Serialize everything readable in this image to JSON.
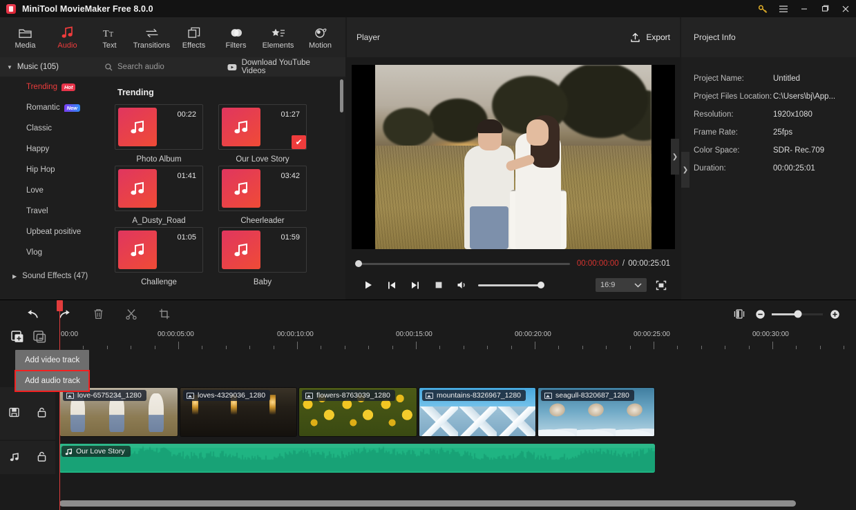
{
  "window": {
    "title": "MiniTool MovieMaker Free 8.0.0",
    "buttons": {
      "key": "key-icon",
      "menu": "hamburger-icon",
      "minimize": "—",
      "maximize": "❐",
      "close": "✕"
    }
  },
  "toolbar": {
    "tabs": [
      {
        "label": "Media",
        "icon": "folder-icon",
        "active": false
      },
      {
        "label": "Audio",
        "icon": "music-note-icon",
        "active": true
      },
      {
        "label": "Text",
        "icon": "text-icon",
        "active": false
      },
      {
        "label": "Transitions",
        "icon": "transitions-icon",
        "active": false
      },
      {
        "label": "Effects",
        "icon": "effects-icon",
        "active": false
      },
      {
        "label": "Filters",
        "icon": "filters-icon",
        "active": false
      },
      {
        "label": "Elements",
        "icon": "elements-icon",
        "active": false
      },
      {
        "label": "Motion",
        "icon": "motion-icon",
        "active": false
      }
    ]
  },
  "categories": {
    "music_header": "Music (105)",
    "items": [
      {
        "label": "Trending",
        "badge": "Hot",
        "badge_type": "red",
        "active": true
      },
      {
        "label": "Romantic",
        "badge": "New",
        "badge_type": "blue",
        "active": false
      },
      {
        "label": "Classic",
        "badge": "",
        "badge_type": "",
        "active": false
      },
      {
        "label": "Happy",
        "badge": "",
        "badge_type": "",
        "active": false
      },
      {
        "label": "Hip Hop",
        "badge": "",
        "badge_type": "",
        "active": false
      },
      {
        "label": "Love",
        "badge": "",
        "badge_type": "",
        "active": false
      },
      {
        "label": "Travel",
        "badge": "",
        "badge_type": "",
        "active": false
      },
      {
        "label": "Upbeat positive",
        "badge": "",
        "badge_type": "",
        "active": false
      },
      {
        "label": "Vlog",
        "badge": "",
        "badge_type": "",
        "active": false
      }
    ],
    "sound_effects": "Sound Effects (47)"
  },
  "library": {
    "search_placeholder": "Search audio",
    "download_label": "Download YouTube Videos",
    "section_title": "Trending",
    "tracks": [
      {
        "name": "Photo Album",
        "duration": "00:22",
        "selected": false
      },
      {
        "name": "Our Love Story",
        "duration": "01:27",
        "selected": true
      },
      {
        "name": "A_Dusty_Road",
        "duration": "01:41",
        "selected": false
      },
      {
        "name": "Cheerleader",
        "duration": "03:42",
        "selected": false
      },
      {
        "name": "Challenge",
        "duration": "01:05",
        "selected": false
      },
      {
        "name": "Baby",
        "duration": "01:59",
        "selected": false
      }
    ]
  },
  "player": {
    "title": "Player",
    "export_label": "Export",
    "current_time": "00:00:00:00",
    "separator": "/",
    "total_time": "00:00:25:01",
    "aspect_ratio": "16:9",
    "controls": [
      "play-button",
      "previous-frame-button",
      "next-frame-button",
      "stop-button",
      "volume-button",
      "fullscreen-button"
    ]
  },
  "project_info": {
    "title": "Project Info",
    "rows": [
      {
        "key": "Project Name:",
        "value": "Untitled"
      },
      {
        "key": "Project Files Location:",
        "value": "C:\\Users\\bj\\App..."
      },
      {
        "key": "Resolution:",
        "value": "1920x1080"
      },
      {
        "key": "Frame Rate:",
        "value": "25fps"
      },
      {
        "key": "Color Space:",
        "value": "SDR- Rec.709"
      },
      {
        "key": "Duration:",
        "value": "00:00:25:01"
      }
    ]
  },
  "timeline": {
    "tools": [
      "undo-icon",
      "redo-icon",
      "delete-icon",
      "split-icon",
      "crop-icon"
    ],
    "ruler_labels": [
      "00:00",
      "00:00:05:00",
      "00:00:10:00",
      "00:00:15:00",
      "00:00:20:00",
      "00:00:25:00",
      "00:00:30:00"
    ],
    "context_menu": [
      {
        "label": "Add video track",
        "highlighted": false
      },
      {
        "label": "Add audio track",
        "highlighted": true
      }
    ],
    "video_clips": [
      {
        "label": "love-6575234_1280",
        "style": "g-love1"
      },
      {
        "label": "loves-4329036_1280",
        "style": "g-love2"
      },
      {
        "label": "flowers-8763039_1280",
        "style": "g-flower"
      },
      {
        "label": "mountains-8326967_1280",
        "style": "g-mount"
      },
      {
        "label": "seagull-8320687_1280",
        "style": "g-seag"
      }
    ],
    "audio_clip": {
      "label": "Our Love Story"
    },
    "video_track_icons": [
      "video-track-icon",
      "lock-icon"
    ],
    "audio_track_icons": [
      "audio-track-icon",
      "lock-icon"
    ]
  },
  "colors": {
    "accent_red": "#ee3c3c",
    "highlight_red": "#f42020",
    "audio_green": "#1fb482",
    "playhead_red": "#e23c3c",
    "key_gold": "#e8b42a"
  }
}
